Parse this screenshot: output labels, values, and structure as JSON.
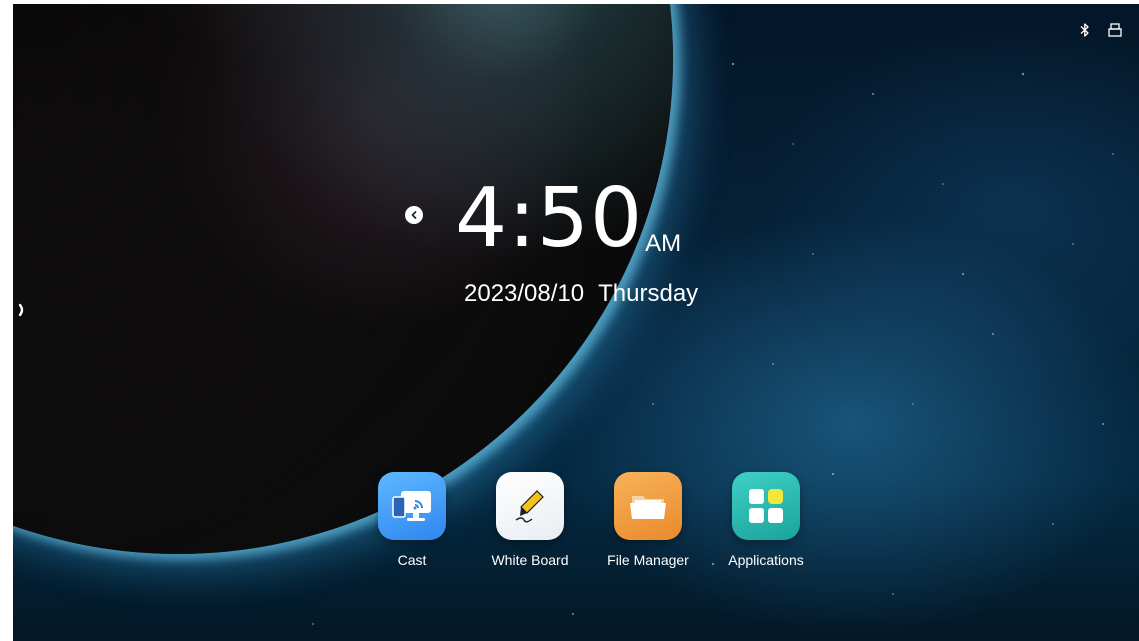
{
  "clock": {
    "time": "4:50",
    "ampm": "AM",
    "date": "2023/08/10",
    "weekday": "Thursday"
  },
  "status_icons": [
    "bluetooth-icon",
    "usb-icon"
  ],
  "apps": [
    {
      "label": "Cast",
      "icon": "cast-icon",
      "color": "#3b8ff2"
    },
    {
      "label": "White Board",
      "icon": "whiteboard-pen-icon",
      "color": "#ffffff"
    },
    {
      "label": "File Manager",
      "icon": "folder-icon",
      "color": "#ee9a3a"
    },
    {
      "label": "Applications",
      "icon": "app-grid-icon",
      "color": "#22b5ac"
    }
  ]
}
